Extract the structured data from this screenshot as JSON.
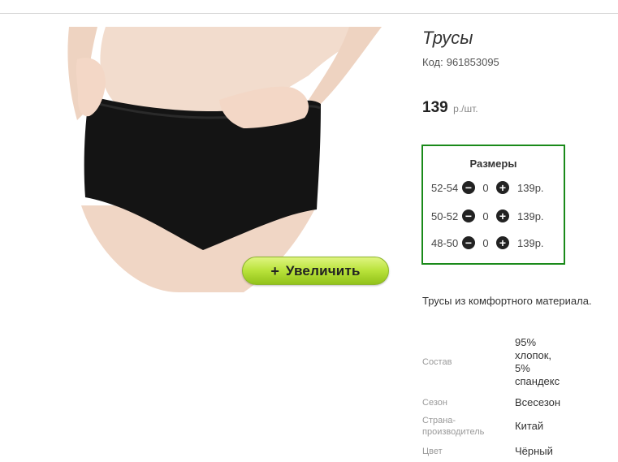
{
  "product": {
    "title": "Трусы",
    "code_label": "Код:",
    "code_value": "961853095",
    "price_value": "139",
    "price_unit": "р./шт.",
    "description": "Трусы из комфортного материала."
  },
  "image": {
    "zoom_plus": "+",
    "zoom_label": "Увеличить"
  },
  "sizes": {
    "title": "Размеры",
    "rows": [
      {
        "size": "52-54",
        "minus": "−",
        "qty": "0",
        "plus": "+",
        "price": "139р."
      },
      {
        "size": "50-52",
        "minus": "−",
        "qty": "0",
        "plus": "+",
        "price": "139р."
      },
      {
        "size": "48-50",
        "minus": "−",
        "qty": "0",
        "plus": "+",
        "price": "139р."
      }
    ]
  },
  "specs": [
    {
      "key": "Состав",
      "value_lines": [
        "95%",
        "хлопок,",
        "5%",
        "спандекс"
      ]
    },
    {
      "key": "Сезон",
      "value_lines": [
        "Всесезон"
      ]
    },
    {
      "key_lines": [
        "Страна-",
        "производитель"
      ],
      "value_lines": [
        "Китай"
      ]
    },
    {
      "key": "Цвет",
      "value_lines": [
        "Чёрный"
      ]
    }
  ],
  "colors": {
    "sizes_border": "#1a8a1a",
    "zoom_button": "#b8e23a"
  },
  "icons": {
    "minus": "minus-circle-icon",
    "plus": "plus-circle-icon"
  }
}
